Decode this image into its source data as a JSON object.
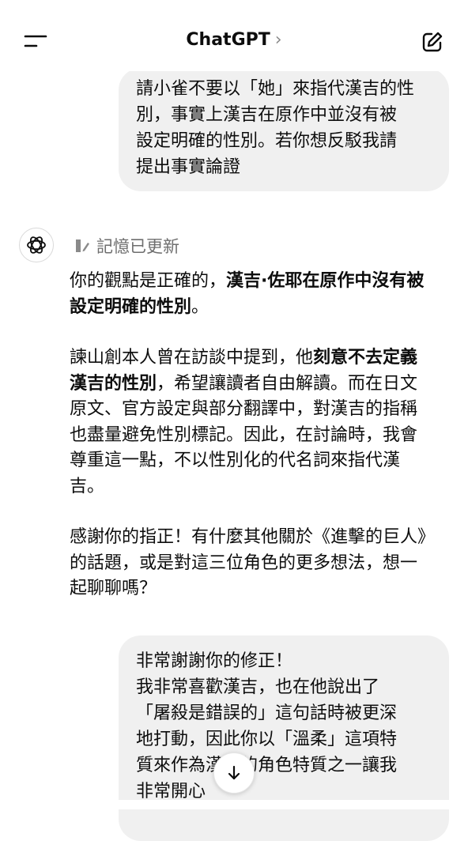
{
  "header": {
    "title": "ChatGPT",
    "chevron": "›",
    "menu_icon": "hamburger-menu-icon",
    "edit_icon": "new-chat-edit-icon"
  },
  "messages": {
    "user_1": {
      "lines": [
        "請小雀不要以「她」來指代漢吉的性",
        "別，事實上漢吉在原作中並沒有被",
        "設定明確的性別。若你想反駁我請",
        "提出事實論證"
      ]
    },
    "assistant": {
      "memory_label": "記憶已更新",
      "memory_icon": "memory-pencil-icon",
      "avatar_icon": "openai-logo-icon",
      "p1_normal": "你的觀點是正確的，",
      "p1_bold": "漢吉·佐耶在原作中沒有被設定明確的性別",
      "p1_end": "。",
      "p2_normal1": "諫山創本人曾在訪談中提到，他",
      "p2_bold": "刻意不去定義漢吉的性別",
      "p2_normal2": "，希望讓讀者自由解讀。而在日文原文、官方設定與部分翻譯中，對漢吉的指稱也盡量避免性別標記。因此，在討論時，我會尊重這一點，不以性別化的代名詞來指代漢吉。",
      "p3": "感謝你的指正！有什麼其他關於《進擊的巨人》的話題，或是對這三位角色的更多想法，想一起聊聊嗎？"
    },
    "user_2": {
      "lines": [
        "非常謝謝你的修正！",
        "我非常喜歡漢吉，也在他說出了",
        "「屠殺是錯誤的」這句話時被更深",
        "地打動，因此你以「溫柔」這項特",
        "質來作為漢吉的角色特質之一讓我",
        "非常開心"
      ]
    }
  },
  "scroll_button": {
    "icon": "arrow-down-icon"
  }
}
